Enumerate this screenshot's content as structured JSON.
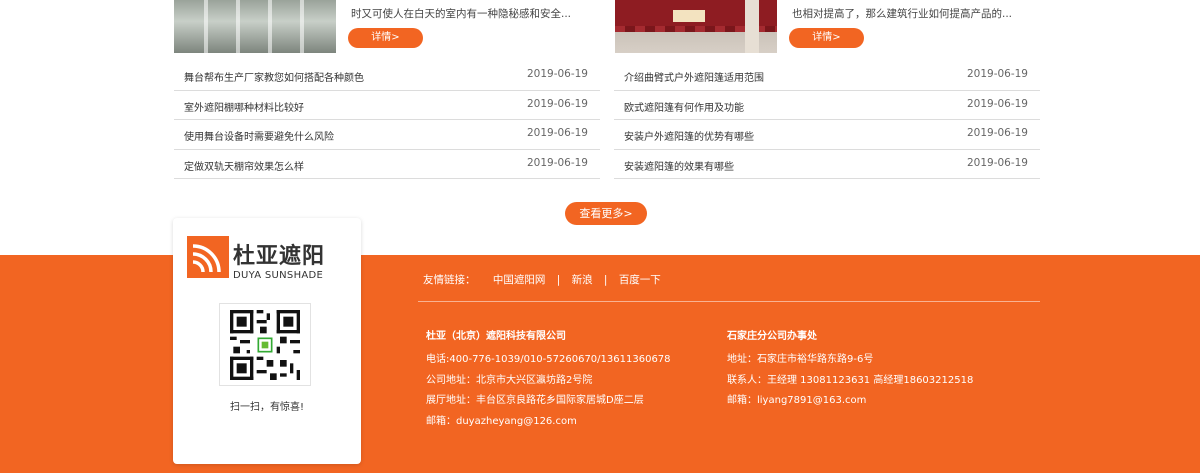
{
  "news": {
    "featured": [
      {
        "desc": "时又可使人在白天的室内有一种隐秘感和安全...",
        "button": "详情>"
      },
      {
        "desc": "也相对提高了，那么建筑行业如何提高产品的...",
        "button": "详情>"
      }
    ],
    "left_list": [
      {
        "title": "舞台帮布生产厂家教您如何搭配各种颜色",
        "date": "2019-06-19"
      },
      {
        "title": "室外遮阳棚哪种材料比较好",
        "date": "2019-06-19"
      },
      {
        "title": "使用舞台设备时需要避免什么风险",
        "date": "2019-06-19"
      },
      {
        "title": "定做双轨天棚帘效果怎么样",
        "date": "2019-06-19"
      }
    ],
    "right_list": [
      {
        "title": "介绍曲臂式户外遮阳篷适用范围",
        "date": "2019-06-19"
      },
      {
        "title": "欧式遮阳篷有何作用及功能",
        "date": "2019-06-19"
      },
      {
        "title": "安装户外遮阳篷的优势有哪些",
        "date": "2019-06-19"
      },
      {
        "title": "安装遮阳篷的效果有哪些",
        "date": "2019-06-19"
      }
    ],
    "more_button": "查看更多>"
  },
  "brand": {
    "name_cn": "杜亚遮阳",
    "name_en": "DUYA SUNSHADE",
    "scan_text": "扫一扫，有惊喜!"
  },
  "footer": {
    "links_label": "友情链接：",
    "links": [
      "中国遮阳网",
      "新浪",
      "百度一下"
    ],
    "separator": "|",
    "company": {
      "title": "杜亚（北京）遮阳科技有限公司",
      "lines": [
        "电话:400-776-1039/010-57260670/13611360678",
        "公司地址：北京市大兴区瀛坊路2号院",
        "展厅地址：丰台区京良路花乡国际家居城D座二层",
        "邮箱：duyazheyang@126.com"
      ]
    },
    "branch": {
      "title": "石家庄分公司办事处",
      "lines": [
        "地址：石家庄市裕华路东路9-6号",
        "联系人：王经理 13081123631 高经理18603212518",
        "邮箱：liyang7891@163.com"
      ]
    }
  },
  "colors": {
    "accent": "#f26522",
    "text": "#333333",
    "divider": "#dcdcdc"
  }
}
